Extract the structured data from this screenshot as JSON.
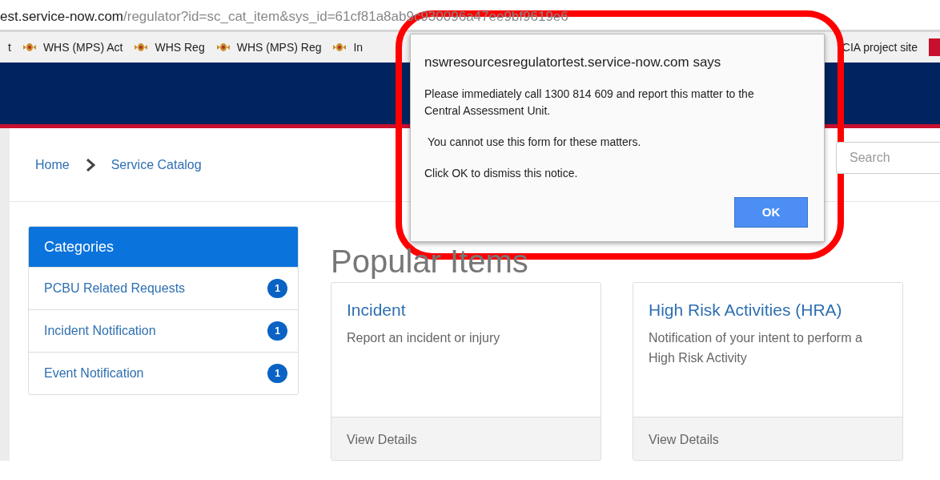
{
  "browser": {
    "url_host": "est.service-now.com",
    "url_path": "/regulator?id=sc_cat_item&sys_id=61cf81a8ab9c930096a47ee9bf9619e6",
    "bookmarks": [
      {
        "label": "t",
        "kind": "plain"
      },
      {
        "label": "WHS (MPS) Act",
        "kind": "crest"
      },
      {
        "label": "WHS Reg",
        "kind": "crest"
      },
      {
        "label": "WHS (MPS) Reg",
        "kind": "crest"
      },
      {
        "label": "In",
        "kind": "crest"
      },
      {
        "label": "CIA project site",
        "kind": "plain"
      },
      {
        "kind": "favicon"
      }
    ]
  },
  "breadcrumb": [
    "Home",
    "Service Catalog"
  ],
  "search": {
    "placeholder": "Search"
  },
  "categories": {
    "title": "Categories",
    "items": [
      {
        "label": "PCBU Related Requests",
        "count": "1"
      },
      {
        "label": "Incident Notification",
        "count": "1"
      },
      {
        "label": "Event Notification",
        "count": "1"
      }
    ]
  },
  "heading": "Popular Items",
  "cards": [
    {
      "title": "Incident",
      "description": "Report an incident or injury",
      "footer": "View Details"
    },
    {
      "title": "High Risk Activities (HRA)",
      "description": "Notification of your intent to perform a High Risk Activity",
      "footer": "View Details"
    }
  ],
  "dialog": {
    "title": "nswresourcesregulatortest.service-now.com says",
    "lines": [
      "Please immediately call 1300 814 609 and report this matter to the Central Assessment Unit.",
      " You cannot use this form for these matters.",
      "Click OK to dismiss this notice."
    ],
    "button": "OK"
  }
}
